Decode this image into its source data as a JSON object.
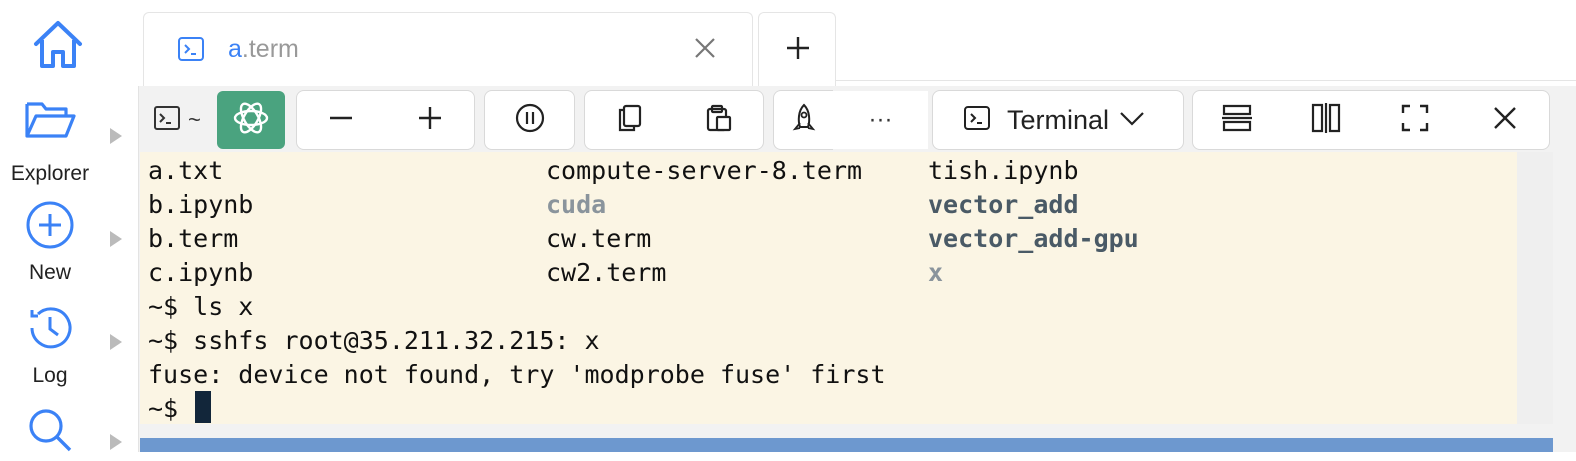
{
  "tabs": [
    {
      "title_highlight": "a",
      "title_rest": ".term"
    }
  ],
  "sidebar": {
    "items": [
      {
        "label": "Explorer",
        "icon": "folder-open-icon"
      },
      {
        "label": "New",
        "icon": "plus-circle-icon"
      },
      {
        "label": "Log",
        "icon": "history-icon"
      },
      {
        "label": "",
        "icon": "search-icon"
      }
    ]
  },
  "toolbar": {
    "prompt_label": "~",
    "more_label": "···",
    "terminal_select": "Terminal"
  },
  "terminal": {
    "listing_rows": [
      [
        {
          "text": "a.txt",
          "style": "normal"
        },
        {
          "text": "compute-server-8.term",
          "style": "normal"
        },
        {
          "text": "tish.ipynb",
          "style": "normal"
        }
      ],
      [
        {
          "text": "b.ipynb",
          "style": "normal"
        },
        {
          "text": "cuda",
          "style": "dim"
        },
        {
          "text": "vector_add",
          "style": "bold"
        }
      ],
      [
        {
          "text": "b.term",
          "style": "normal"
        },
        {
          "text": "cw.term",
          "style": "normal"
        },
        {
          "text": "vector_add-gpu",
          "style": "bold"
        }
      ],
      [
        {
          "text": "c.ipynb",
          "style": "normal"
        },
        {
          "text": "cw2.term",
          "style": "normal"
        },
        {
          "text": "x",
          "style": "dim"
        }
      ]
    ],
    "lines": [
      "~$ ls x",
      "~$ sshfs root@35.211.32.215: x",
      "fuse: device not found, try 'modprobe fuse' first",
      "~$ "
    ]
  },
  "colors": {
    "terminal_bg": "#fbf5e4",
    "accent_blue": "#3b82f6",
    "chatgpt_green": "#4aa37f",
    "status_bar": "#6d98cf"
  }
}
